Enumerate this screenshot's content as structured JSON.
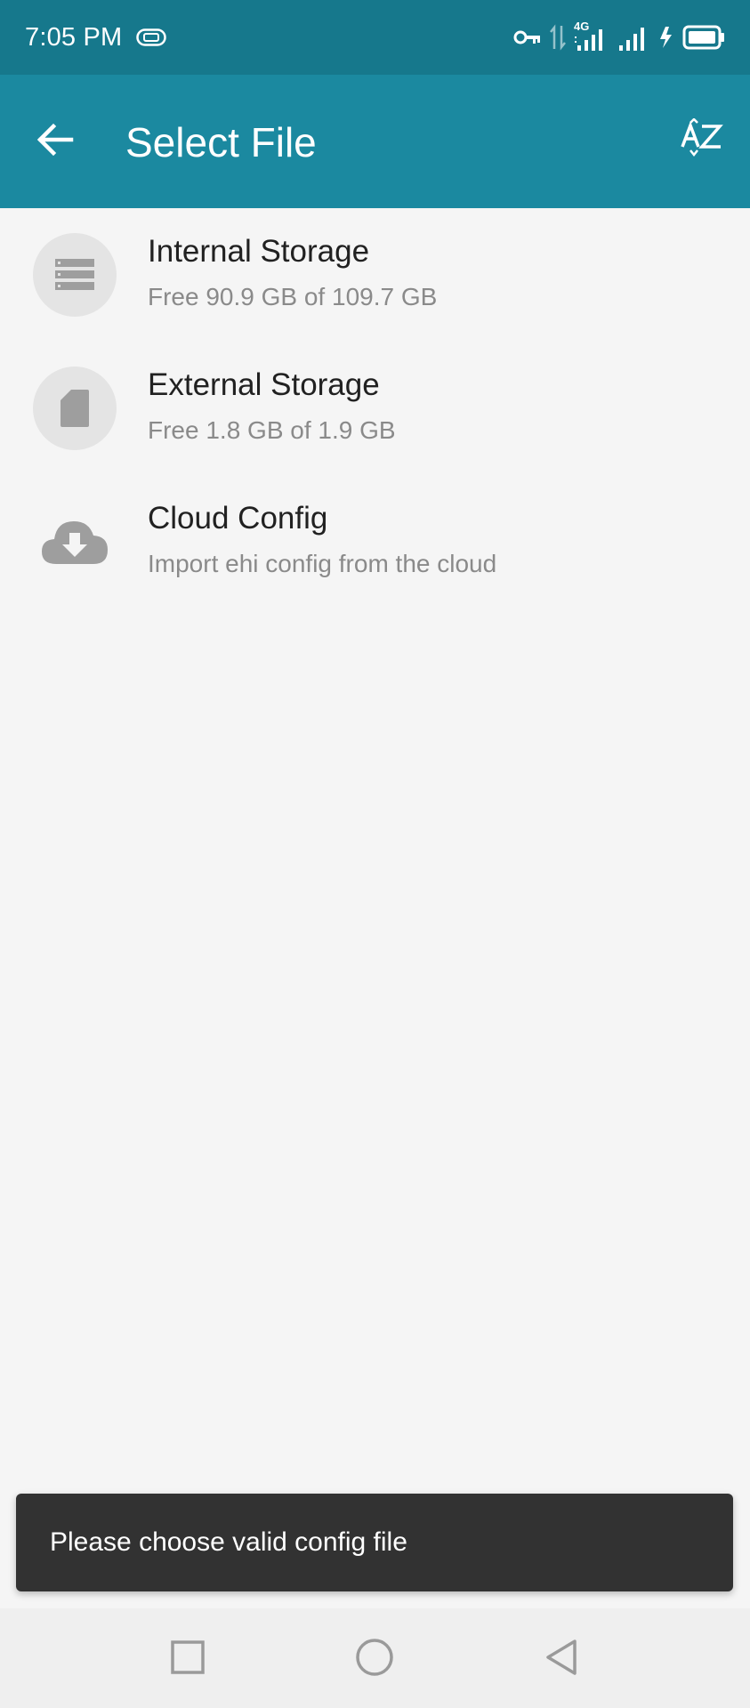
{
  "status_bar": {
    "time": "7:05 PM",
    "network_label": "4G"
  },
  "app_bar": {
    "title": "Select File",
    "back_icon": "arrow-back-icon",
    "sort_icon": "sort-alpha-icon"
  },
  "items": [
    {
      "title": "Internal Storage",
      "subtitle": "Free 90.9 GB of 109.7 GB",
      "icon": "storage-icon"
    },
    {
      "title": "External Storage",
      "subtitle": "Free 1.8 GB of 1.9 GB",
      "icon": "sd-card-icon"
    },
    {
      "title": "Cloud Config",
      "subtitle": "Import ehi config from the cloud",
      "icon": "cloud-download-icon"
    }
  ],
  "snackbar": {
    "message": "Please choose valid config file"
  },
  "nav_bar": {
    "recents_icon": "square-icon",
    "home_icon": "circle-icon",
    "back_icon": "triangle-back-icon"
  },
  "colors": {
    "status_bar": "#16788c",
    "app_bar": "#1b89a0",
    "background": "#f5f5f5",
    "snackbar": "#323232",
    "icon_gray": "#9e9e9e"
  }
}
